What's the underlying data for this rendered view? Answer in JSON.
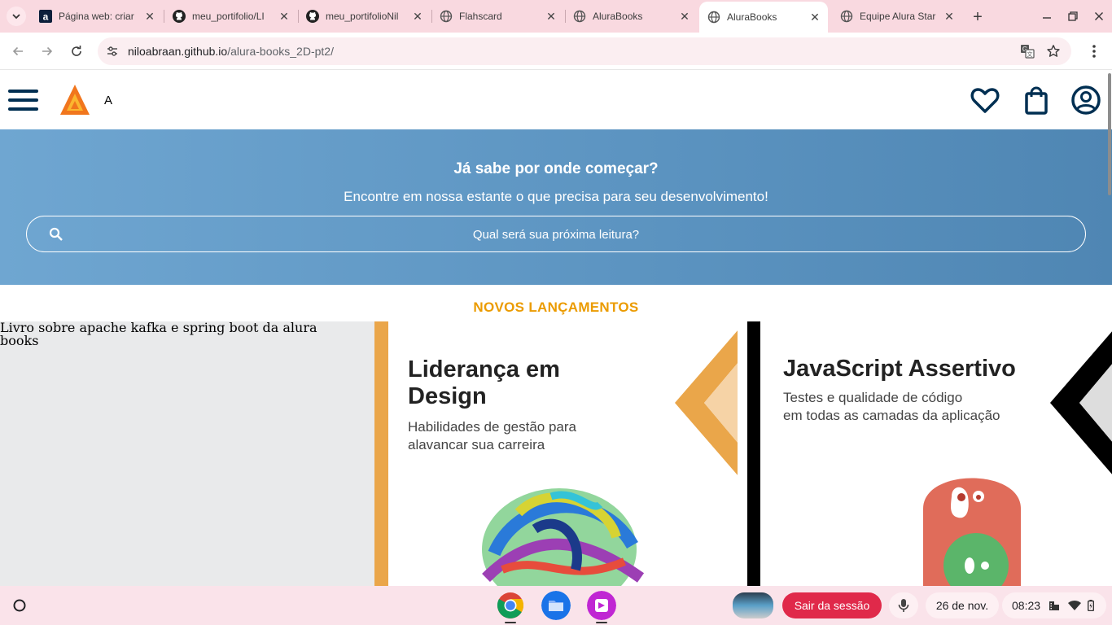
{
  "browser": {
    "tabs": [
      {
        "title": "Página web: criar",
        "favicon": "alura-a-icon"
      },
      {
        "title": "meu_portifolio/LI",
        "favicon": "github-icon"
      },
      {
        "title": "meu_portifolioNil",
        "favicon": "github-icon"
      },
      {
        "title": "Flahscard",
        "favicon": "globe-icon"
      },
      {
        "title": "AluraBooks",
        "favicon": "globe-icon"
      },
      {
        "title": "AluraBooks",
        "favicon": "globe-icon",
        "active": true
      },
      {
        "title": "Equipe Alura Star",
        "favicon": "globe-icon"
      }
    ],
    "url_host": "niloabraan.github.io",
    "url_path": "/alura-books_2D-pt2/"
  },
  "site": {
    "brand_letter": "A",
    "colors": {
      "navy": "#002f52",
      "orange": "#eb9b00",
      "hero": "#5b93c0"
    }
  },
  "hero": {
    "title": "Já sabe por onde começar?",
    "subtitle": "Encontre em nossa estante o que precisa para seu desenvolvimento!",
    "search_placeholder": "Qual será sua próxima leitura?"
  },
  "releases": {
    "title": "NOVOS LANÇAMENTOS",
    "books": [
      {
        "alt": "Livro sobre apache kafka e spring boot da alura books",
        "broken": true
      },
      {
        "title_line1": "Liderança em",
        "title_line2": "Design",
        "sub_line1": "Habilidades de gestão para",
        "sub_line2": "alavancar sua carreira"
      },
      {
        "title_line1": "JavaScript Assertivo",
        "sub_line1": "Testes e qualidade de código",
        "sub_line2": "em todas as camadas da aplicação"
      }
    ]
  },
  "shelf": {
    "logout_label": "Sair da sessão",
    "date": "26 de nov.",
    "time": "08:23"
  }
}
